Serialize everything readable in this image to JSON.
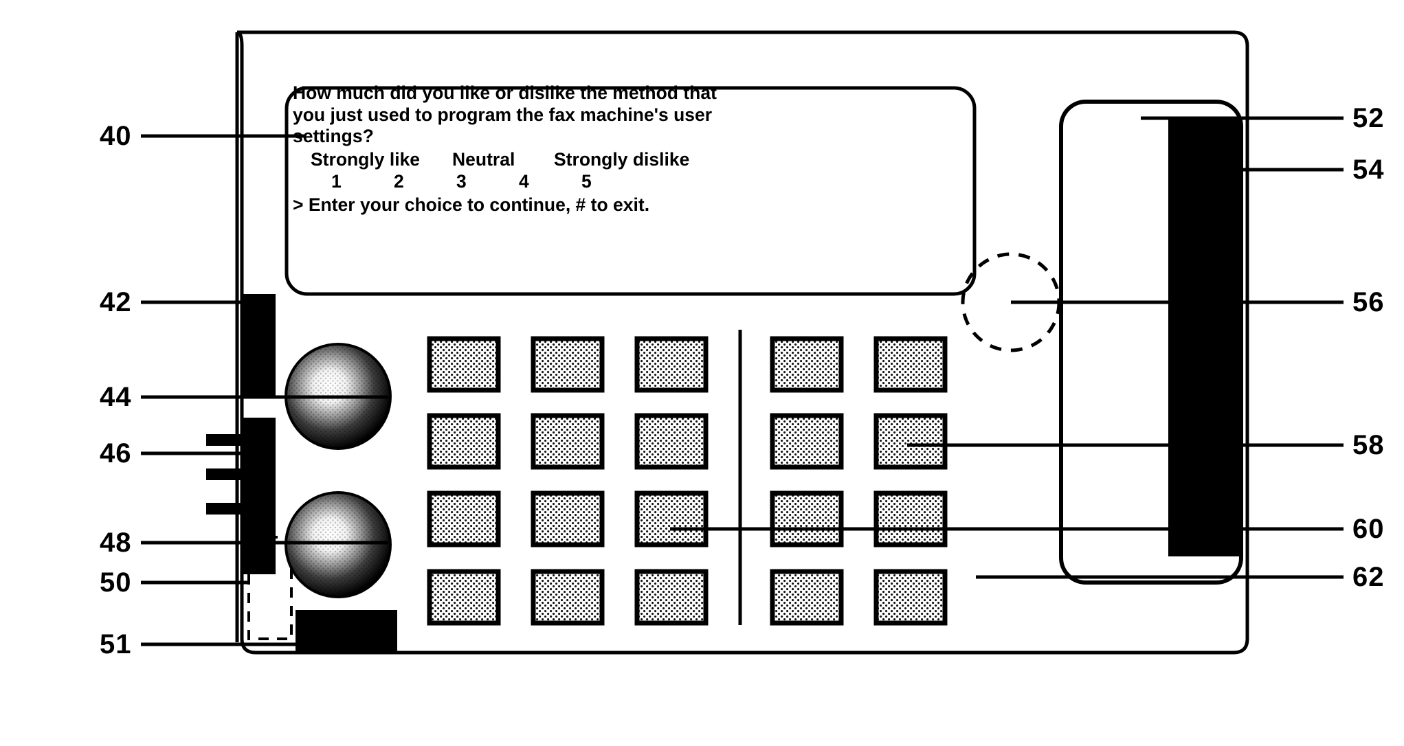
{
  "figure": {
    "type": "patent-line-drawing",
    "subject": "fax machine control panel with LCD display and keypad"
  },
  "display": {
    "name": "lcd-display",
    "question_line_1": "How much did you like or dislike the method that",
    "question_line_2": "you just used to program the fax machine's user",
    "question_line_3": "settings?",
    "scale_labels": [
      "Strongly like",
      "Neutral",
      "Strongly dislike"
    ],
    "scale_numbers": [
      "1",
      "2",
      "3",
      "4",
      "5"
    ],
    "prompt": "> Enter  your choice to continue, # to exit."
  },
  "reference_numerals": {
    "left": [
      {
        "id": "40",
        "label": "40",
        "target": "lcd-display"
      },
      {
        "id": "42",
        "label": "42",
        "target": "left-black-bar-upper"
      },
      {
        "id": "44",
        "label": "44",
        "target": "upper-knob"
      },
      {
        "id": "46",
        "label": "46",
        "target": "connector-tabs"
      },
      {
        "id": "48",
        "label": "48",
        "target": "lower-knob"
      },
      {
        "id": "50",
        "label": "50",
        "target": "dashed-rectangle"
      },
      {
        "id": "51",
        "label": "51",
        "target": "bottom-black-bar"
      }
    ],
    "right": [
      {
        "id": "52",
        "label": "52",
        "target": "handset-cradle"
      },
      {
        "id": "54",
        "label": "54",
        "target": "right-black-bar"
      },
      {
        "id": "56",
        "label": "56",
        "target": "dashed-circle"
      },
      {
        "id": "58",
        "label": "58",
        "target": "keypad-key-right-col"
      },
      {
        "id": "60",
        "label": "60",
        "target": "keypad-key-center"
      },
      {
        "id": "62",
        "label": "62",
        "target": "keypad-area"
      }
    ]
  },
  "controls": {
    "knobs": [
      {
        "name": "upper-knob",
        "ref": "44"
      },
      {
        "name": "lower-knob",
        "ref": "48"
      }
    ],
    "keypad": {
      "name": "keypad",
      "rows": 4,
      "left_columns": 3,
      "right_columns": 2,
      "total_keys": 20,
      "divider": "vertical-line"
    },
    "handset": {
      "name": "handset",
      "ref": "52"
    }
  },
  "colors": {
    "ink": "#000000",
    "paper": "#ffffff",
    "key_fill": "#b8b8b8"
  }
}
